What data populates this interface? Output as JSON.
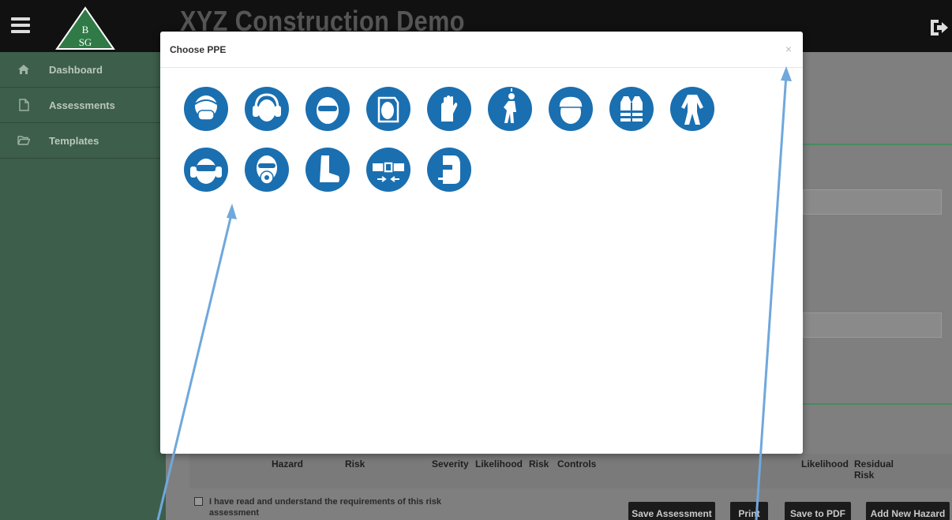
{
  "header": {
    "app_title": "XYZ Construction Demo",
    "logo_text_top": "B",
    "logo_text_bottom": "SG"
  },
  "sidebar": {
    "items": [
      {
        "label": "Dashboard",
        "icon": "home-icon"
      },
      {
        "label": "Assessments",
        "icon": "document-icon"
      },
      {
        "label": "Templates",
        "icon": "folder-open-icon"
      }
    ]
  },
  "modal": {
    "title": "Choose PPE",
    "close_label": "×",
    "ppe_items": [
      {
        "icon": "face-mask-icon"
      },
      {
        "icon": "ear-defenders-icon"
      },
      {
        "icon": "safety-glasses-icon"
      },
      {
        "icon": "face-shield-icon"
      },
      {
        "icon": "gloves-icon"
      },
      {
        "icon": "safety-harness-icon"
      },
      {
        "icon": "hard-hat-icon"
      },
      {
        "icon": "hi-vis-vest-icon"
      },
      {
        "icon": "coveralls-icon"
      },
      {
        "icon": "goggles-and-ear-defenders-icon"
      },
      {
        "icon": "respirator-icon"
      },
      {
        "icon": "safety-boots-icon"
      },
      {
        "icon": "seat-belt-icon"
      },
      {
        "icon": "welding-mask-icon"
      }
    ]
  },
  "table": {
    "headers": [
      "Hazard",
      "Risk",
      "Severity",
      "Likelihood",
      "Risk",
      "Controls",
      "Likelihood",
      "Residual Risk"
    ]
  },
  "footer": {
    "agreement_text": "I have read and understand the requirements of this risk assessment",
    "buttons": [
      "Save Assessment",
      "Print",
      "Save to PDF",
      "Add New Hazard"
    ]
  },
  "colors": {
    "ppe_blue": "#1a6fb0",
    "sidebar_green": "#3d5e4a",
    "annotation_arrow": "#6fa8dc"
  }
}
